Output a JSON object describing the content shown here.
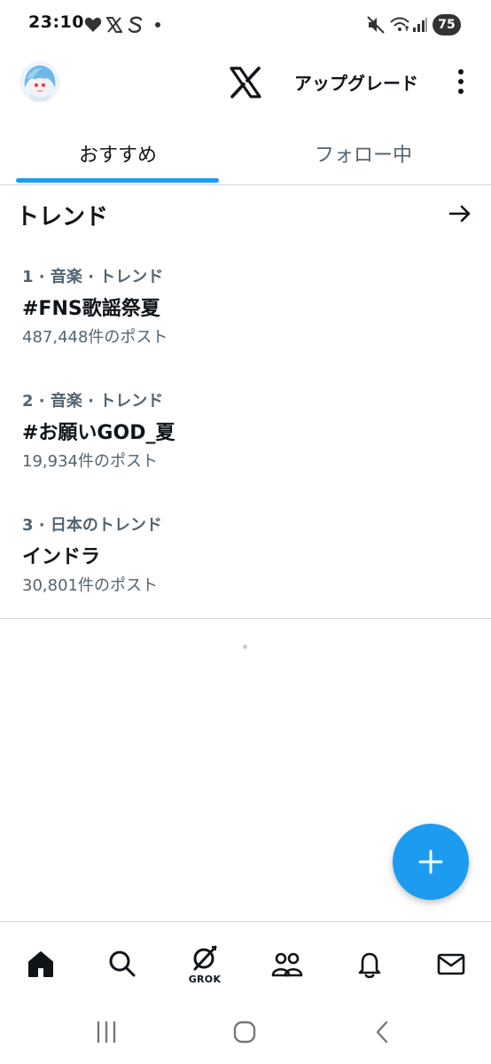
{
  "status_bar": {
    "time": "23:10",
    "battery": "75",
    "left_icons": [
      "heart-icon",
      "x-icon",
      "s-icon",
      "dot-icon"
    ],
    "right_icons": [
      "mute-icon",
      "wifi-icon",
      "signal-icon",
      "battery-icon"
    ]
  },
  "header": {
    "upgrade_label": "アップグレード",
    "logo": "x-logo-icon"
  },
  "tabs": [
    {
      "label": "おすすめ",
      "active": true
    },
    {
      "label": "フォロー中",
      "active": false
    }
  ],
  "accent_color": "#1d9bf0",
  "trends": {
    "title": "トレンド",
    "items": [
      {
        "meta": "1 · 音楽 · トレンド",
        "name": "#FNS歌謡祭夏",
        "count": "487,448件のポスト"
      },
      {
        "meta": "2 · 音楽 · トレンド",
        "name": "#お願いGOD_夏",
        "count": "19,934件のポスト"
      },
      {
        "meta": "3 · 日本のトレンド",
        "name": "インドラ",
        "count": "30,801件のポスト"
      }
    ]
  },
  "bottom_nav": {
    "items": [
      "home-icon",
      "search-icon",
      "grok-icon",
      "communities-icon",
      "notifications-icon",
      "messages-icon"
    ],
    "grok_label": "GROK"
  }
}
